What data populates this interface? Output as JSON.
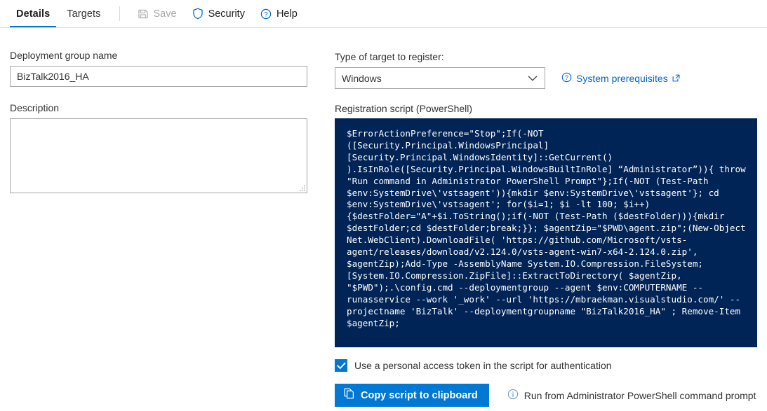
{
  "toolbar": {
    "tabs": [
      {
        "label": "Details",
        "active": true
      },
      {
        "label": "Targets",
        "active": false
      }
    ],
    "save_label": "Save",
    "security_label": "Security",
    "help_label": "Help"
  },
  "left": {
    "name_label": "Deployment group name",
    "name_value": "BizTalk2016_HA",
    "name_placeholder": "",
    "description_label": "Description",
    "description_value": "",
    "description_placeholder": ""
  },
  "right": {
    "target_type_label": "Type of target to register:",
    "target_type_value": "Windows",
    "target_type_options": [
      "Windows"
    ],
    "prerequisites_link": "System prerequisites",
    "script_label": "Registration script (PowerShell)",
    "script": "$ErrorActionPreference=\"Stop\";If(-NOT ([Security.Principal.WindowsPrincipal][Security.Principal.WindowsIdentity]::GetCurrent() ).IsInRole([Security.Principal.WindowsBuiltInRole] “Administrator”)){ throw \"Run command in Administrator PowerShell Prompt\"};If(-NOT (Test-Path $env:SystemDrive\\'vstsagent')){mkdir $env:SystemDrive\\'vstsagent'}; cd $env:SystemDrive\\'vstsagent'; for($i=1; $i -lt 100; $i++) {$destFolder=\"A\"+$i.ToString();if(-NOT (Test-Path ($destFolder))){mkdir $destFolder;cd $destFolder;break;}}; $agentZip=\"$PWD\\agent.zip\";(New-Object Net.WebClient).DownloadFile( 'https://github.com/Microsoft/vsts-agent/releases/download/v2.124.0/vsts-agent-win7-x64-2.124.0.zip', $agentZip);Add-Type -AssemblyName System.IO.Compression.FileSystem; [System.IO.Compression.ZipFile]::ExtractToDirectory( $agentZip, \"$PWD\");.\\config.cmd --deploymentgroup --agent $env:COMPUTERNAME --runasservice --work '_work' --url 'https://mbraekman.visualstudio.com/' --projectname 'BizTalk' --deploymentgroupname \"BizTalk2016_HA\" ; Remove-Item $agentZip;",
    "pat_checkbox_label": "Use a personal access token in the script for authentication",
    "pat_checked": true,
    "copy_button_label": "Copy script to clipboard",
    "run_hint": "Run from Administrator PowerShell command prompt"
  },
  "colors": {
    "accent": "#0078d4",
    "link": "#0066cc",
    "console_bg": "#012456",
    "disabled": "#a6a6a6"
  }
}
